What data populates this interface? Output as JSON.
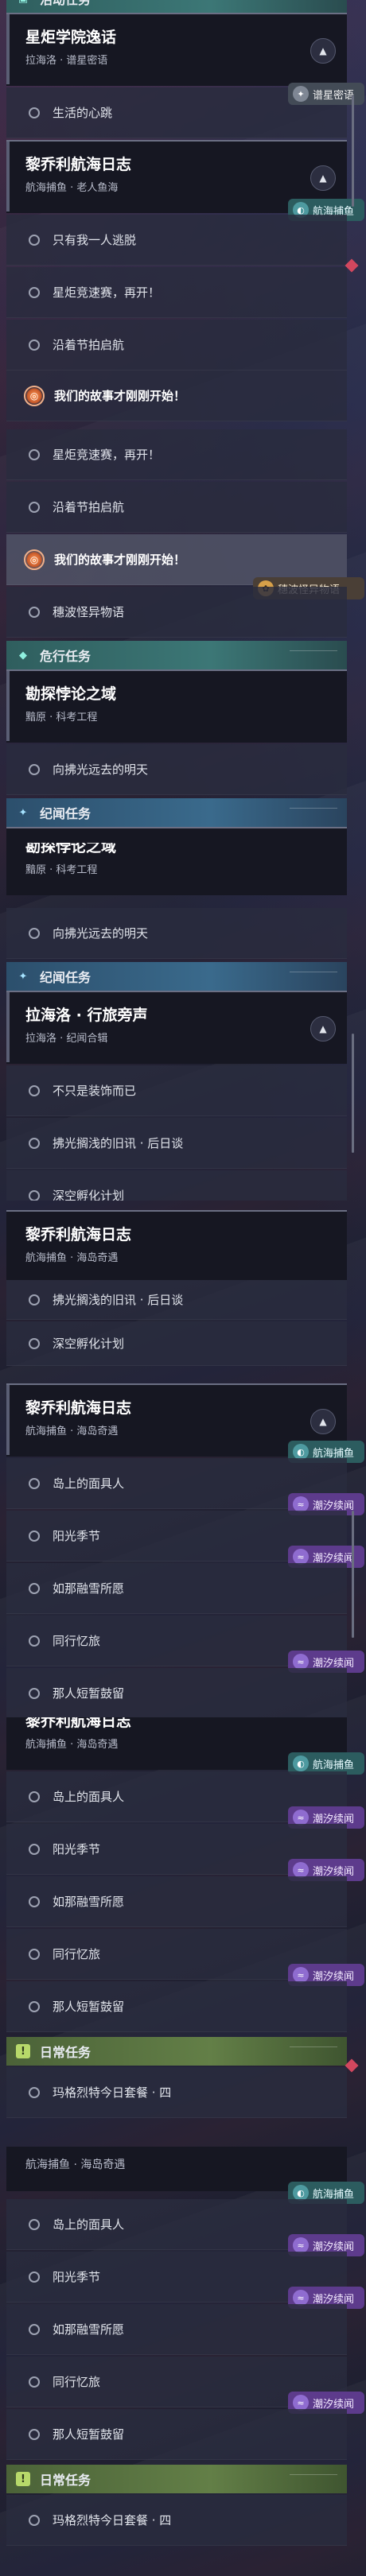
{
  "groups": {
    "commission": "活动任务",
    "danger": "危行任务",
    "journey": "纪闻任务",
    "daily": "日常任务"
  },
  "quests": {
    "xingju": {
      "title": "星炬学院逸话",
      "subtitle": "拉海洛 · 谱星密语"
    },
    "liqiao_old": {
      "title": "黎乔利航海日志",
      "subtitle": "航海捕鱼 · 老人鱼海"
    },
    "kantan": {
      "title": "勘探悖论之域",
      "subtitle": "黯原 · 科考工程"
    },
    "luolai": {
      "title": "拉海洛 · 行旅旁声",
      "subtitle": "拉海洛 · 纪闻合辑"
    },
    "liqiao_island": {
      "title": "黎乔利航海日志",
      "subtitle": "航海捕鱼 · 海岛奇遇"
    },
    "liqiao_island_cut": {
      "title": "黎乔利航海日志",
      "subtitle": "航海捕鱼 · 海岛奇遇"
    }
  },
  "steps": {
    "life": "生活的心跳",
    "alone": "只有我一人逃脱",
    "meet": "星炬竞速赛，再开！",
    "set_sail": "沿着节拍启航",
    "story_begin": "我们的故事才刚刚开始！",
    "tale": "穗波怪异物语",
    "far": "向拂光远去的明天",
    "not_only": "不只是装饰而已",
    "old_note": "拂光搁浅的旧讯 · 后日谈",
    "incubate": "深空孵化计划",
    "mask": "岛上的面具人",
    "sun": "阳光季节",
    "snow": "如那融雪所愿",
    "memory": "同行忆旅",
    "vow": "那人短暂鼓留",
    "daily_set": "玛格烈特今日套餐 · 四"
  },
  "badges": {
    "star": "谱星密语",
    "sea": "航海捕鱼",
    "tide": "潮汐续闻",
    "tale": "穗波怪异物语"
  },
  "icons": {
    "commission": "quest-book-icon",
    "danger": "diamond-icon",
    "journey": "sparkle-icon",
    "daily": "daily-calendar-icon",
    "collapse": "chevron-up-icon",
    "step": "circle-outline-icon",
    "tracking": "target-orb-icon"
  },
  "colors": {
    "danger_band": "#3c7776",
    "journey_band": "#3a6a8c",
    "daily_band": "#637f47",
    "tide_badge": "#5d3b8c",
    "sea_badge": "#2c5c5f",
    "alert_diamond": "#d2475e"
  }
}
